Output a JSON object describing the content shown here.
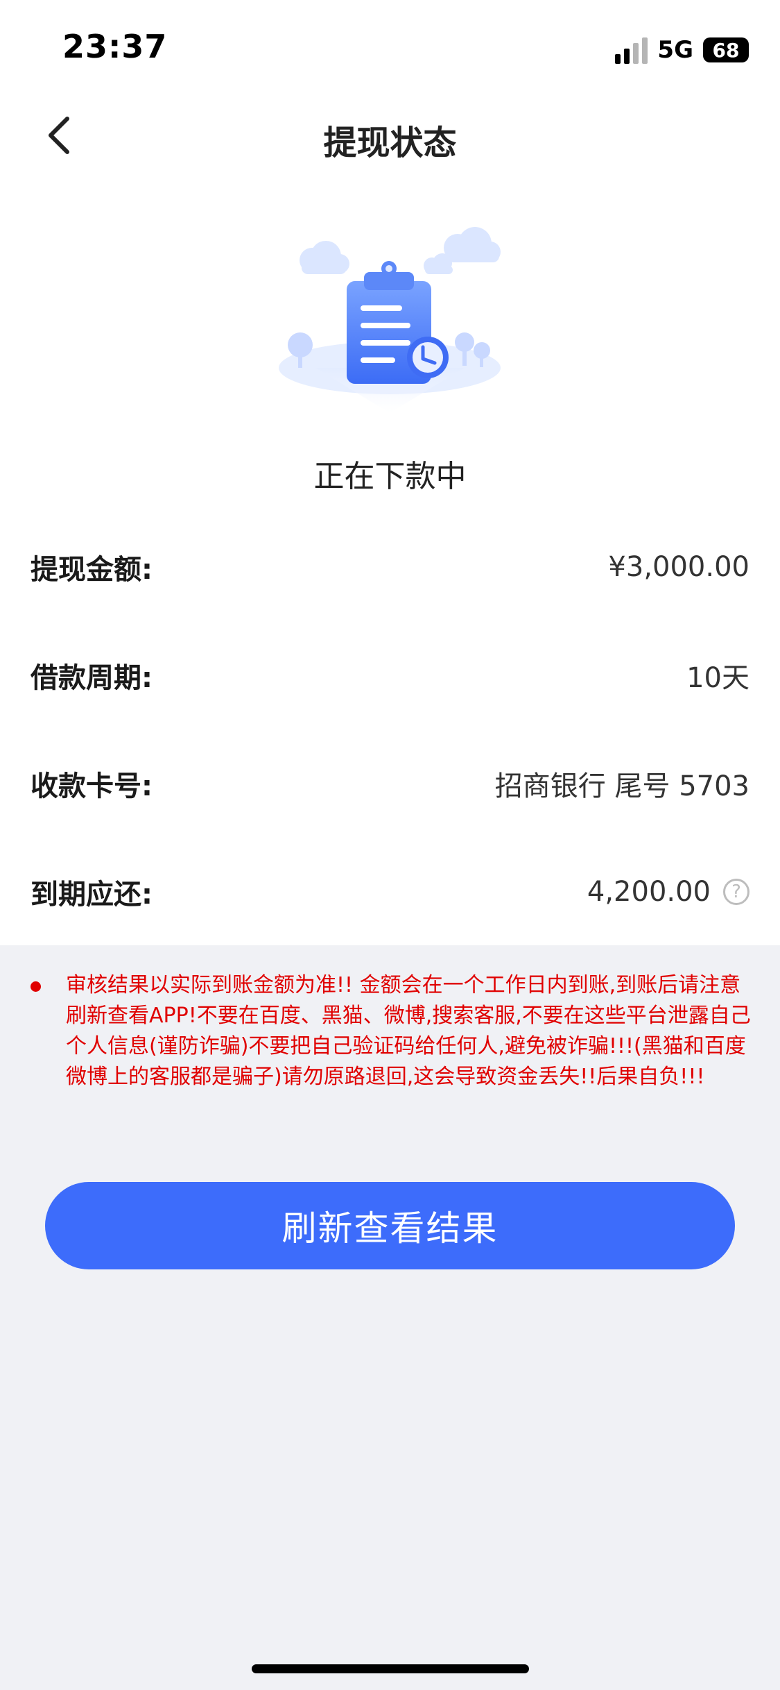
{
  "status_bar": {
    "time": "23:37",
    "network": "5G",
    "battery": "68"
  },
  "header": {
    "title": "提现状态"
  },
  "status": {
    "text": "正在下款中"
  },
  "details": [
    {
      "label": "提现金额:",
      "value": "¥3,000.00"
    },
    {
      "label": "借款周期:",
      "value": "10天"
    },
    {
      "label": "收款卡号:",
      "value": "招商银行 尾号 5703"
    },
    {
      "label": "到期应还:",
      "value": "4,200.00"
    }
  ],
  "notice": {
    "text": "审核结果以实际到账金额为准!! 金额会在一个工作日内到账,到账后请注意刷新查看APP!不要在百度、黑猫、微博,搜索客服,不要在这些平台泄露自己个人信息(谨防诈骗)不要把自己验证码给任何人,避免被诈骗!!!(黑猫和百度微博上的客服都是骗子)请勿原路退回,这会导致资金丢失!!后果自负!!!"
  },
  "refresh_button": {
    "label": "刷新查看结果"
  },
  "colors": {
    "accent": "#3d6cfb",
    "warning": "#e00000",
    "background": "#f0f1f5"
  },
  "icons": {
    "back": "chevron-left-icon",
    "help": "question-circle-icon",
    "illustration": "clipboard-clock-icon"
  }
}
